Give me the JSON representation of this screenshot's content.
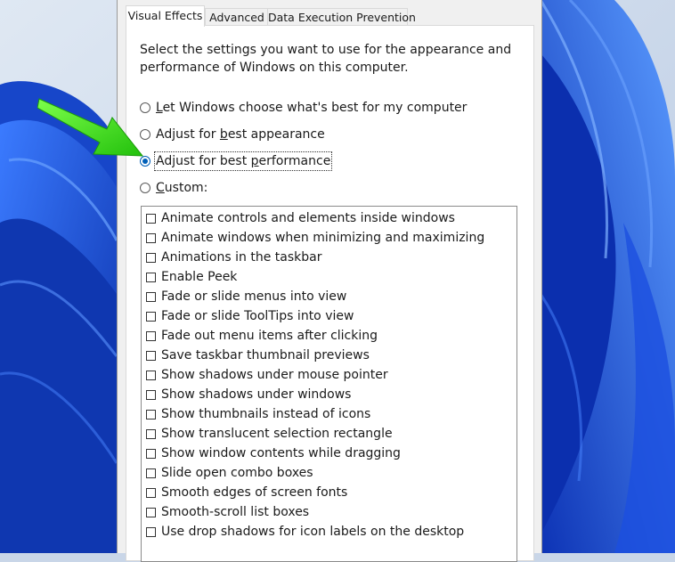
{
  "tabs": [
    {
      "label": "Visual Effects",
      "active": true
    },
    {
      "label": "Advanced",
      "active": false
    },
    {
      "label": "Data Execution Prevention",
      "active": false
    }
  ],
  "description": "Select the settings you want to use for the appearance and performance of Windows on this computer.",
  "radios": [
    {
      "pre": "",
      "ul": "L",
      "post": "et Windows choose what's best for my computer",
      "checked": false
    },
    {
      "pre": "Adjust for ",
      "ul": "b",
      "post": "est appearance",
      "checked": false
    },
    {
      "pre": "Adjust for best ",
      "ul": "p",
      "post": "erformance",
      "checked": true
    },
    {
      "pre": "",
      "ul": "C",
      "post": "ustom:",
      "checked": false
    }
  ],
  "options": [
    "Animate controls and elements inside windows",
    "Animate windows when minimizing and maximizing",
    "Animations in the taskbar",
    "Enable Peek",
    "Fade or slide menus into view",
    "Fade or slide ToolTips into view",
    "Fade out menu items after clicking",
    "Save taskbar thumbnail previews",
    "Show shadows under mouse pointer",
    "Show shadows under windows",
    "Show thumbnails instead of icons",
    "Show translucent selection rectangle",
    "Show window contents while dragging",
    "Slide open combo boxes",
    "Smooth edges of screen fonts",
    "Smooth-scroll list boxes",
    "Use drop shadows for icon labels on the desktop"
  ],
  "colors": {
    "accent": "#005fb8",
    "arrow": "#33d11a",
    "wallpaper_blue": "#1f4fd6"
  }
}
